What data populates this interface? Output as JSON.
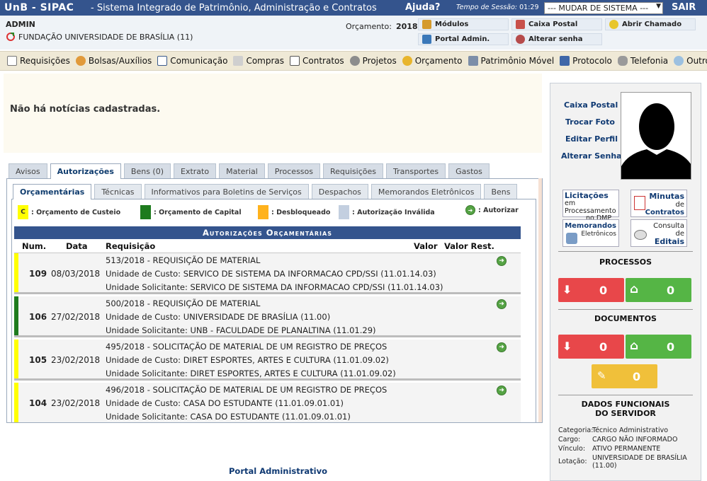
{
  "topbar": {
    "brand": "UnB - SIPAC",
    "system_name": "- Sistema Integrado de Patrimônio, Administração e Contratos",
    "help": "Ajuda?",
    "session_label": "Tempo de Sessão:",
    "session_time": "01:29",
    "system_select": "--- MUDAR DE SISTEMA ---",
    "logout": "SAIR",
    "color": "#34548d"
  },
  "user": {
    "name": "ADMIN",
    "unit": "FUNDAÇÃO UNIVERSIDADE DE BRASÍLIA (11)",
    "budget_label": "Orçamento:",
    "budget_year": "2018"
  },
  "quick_links": {
    "modules": "Módulos",
    "mailbox": "Caixa Postal",
    "open_ticket": "Abrir Chamado",
    "admin_portal": "Portal Admin.",
    "change_password": "Alterar senha"
  },
  "menu": [
    {
      "label": "Requisições",
      "icon": "document-icon"
    },
    {
      "label": "Bolsas/Auxílios",
      "icon": "people-icon"
    },
    {
      "label": "Comunicação",
      "icon": "book-icon"
    },
    {
      "label": "Compras",
      "icon": "cart-icon"
    },
    {
      "label": "Contratos",
      "icon": "contract-icon"
    },
    {
      "label": "Projetos",
      "icon": "projects-icon"
    },
    {
      "label": "Orçamento",
      "icon": "coins-icon"
    },
    {
      "label": "Patrimônio Móvel",
      "icon": "computer-icon"
    },
    {
      "label": "Protocolo",
      "icon": "protocol-icon"
    },
    {
      "label": "Telefonia",
      "icon": "phone-icon"
    },
    {
      "label": "Outros",
      "icon": "search-icon"
    }
  ],
  "news": {
    "message": "Não há notícias cadastradas."
  },
  "main_tabs": [
    "Avisos",
    "Autorizações",
    "Bens (0)",
    "Extrato",
    "Material",
    "Processos",
    "Requisições",
    "Transportes",
    "Gastos"
  ],
  "sub_tabs": [
    "Orçamentárias",
    "Técnicas",
    "Informativos para Boletins de Serviços",
    "Despachos",
    "Memorandos Eletrônicos",
    "Bens"
  ],
  "legend": {
    "custeio": ": Orçamento de Custeio",
    "custeio_mark": "C",
    "capital": ": Orçamento de Capital",
    "desbloqueado": ": Desbloqueado",
    "invalida": ": Autorização Inválida",
    "autorizar": ": Autorizar",
    "colors": {
      "custeio": "#ffff00",
      "capital": "#1e7b1e",
      "desbloqueado": "#ffb21c",
      "invalida": "#c3cfe0"
    }
  },
  "table": {
    "title": "Autorizações Orçamentárias",
    "columns": {
      "num": "Num.",
      "date": "Data",
      "req": "Requisição",
      "value": "Valor",
      "remaining": "Valor Rest."
    },
    "rows": [
      {
        "num": "109",
        "date": "08/03/2018",
        "req": "513/2018 - REQUISIÇÃO DE MATERIAL",
        "cost_unit": "Unidade de Custo: SERVICO DE SISTEMA DA INFORMACAO CPD/SSI (11.01.14.03)",
        "requesting_unit": "Unidade Solicitante: SERVICO DE SISTEMA DA INFORMACAO CPD/SSI (11.01.14.03)",
        "color": "#ffff00"
      },
      {
        "num": "106",
        "date": "27/02/2018",
        "req": "500/2018 - REQUISIÇÃO DE MATERIAL",
        "cost_unit": "Unidade de Custo: UNIVERSIDADE DE BRASÍLIA (11.00)",
        "requesting_unit": "Unidade Solicitante: UNB - FACULDADE DE PLANALTINA (11.01.29)",
        "color": "#1e7b1e"
      },
      {
        "num": "105",
        "date": "23/02/2018",
        "req": "495/2018 - SOLICITAÇÃO DE MATERIAL DE UM REGISTRO DE PREÇOS",
        "cost_unit": "Unidade de Custo: DIRET ESPORTES, ARTES E CULTURA (11.01.09.02)",
        "requesting_unit": "Unidade Solicitante: DIRET ESPORTES, ARTES E CULTURA (11.01.09.02)",
        "color": "#ffff00"
      },
      {
        "num": "104",
        "date": "23/02/2018",
        "req": "496/2018 - SOLICITAÇÃO DE MATERIAL DE UM REGISTRO DE PREÇOS",
        "cost_unit": "Unidade de Custo: CASA DO ESTUDANTE (11.01.09.01.01)",
        "requesting_unit": "Unidade Solicitante: CASA DO ESTUDANTE (11.01.09.01.01)",
        "color": "#ffff00"
      }
    ]
  },
  "footer": {
    "portal_link": "Portal Administrativo"
  },
  "sidebar": {
    "links": [
      "Caixa Postal",
      "Trocar Foto",
      "Editar Perfil",
      "Alterar Senha"
    ],
    "buttons": {
      "licitacoes": [
        "Licitações",
        "em",
        "Processamento",
        "no DMP"
      ],
      "minutas": [
        "Minutas",
        "de",
        "Contratos"
      ],
      "memorandos": [
        "Memorandos",
        "Eletrônicos"
      ],
      "editais": [
        "Consulta",
        "de",
        "Editais"
      ]
    },
    "processes_title": "PROCESSOS",
    "processes_in": "0",
    "processes_home": "0",
    "documents_title": "DOCUMENTOS",
    "documents_in": "0",
    "documents_home": "0",
    "documents_draft": "0",
    "functional_title": "DADOS FUNCIONAIS DO SERVIDOR",
    "functional": {
      "categoria_label": "Categoria:",
      "categoria": "Técnico Administrativo",
      "cargo_label": "Cargo:",
      "cargo": "CARGO NÃO INFORMADO",
      "vinculo_label": "Vínculo:",
      "vinculo": "ATIVO PERMANENTE",
      "lotacao_label": "Lotação:",
      "lotacao": "UNIVERSIDADE DE BRASÍLIA (11.00)"
    },
    "colors": {
      "red": "#e8474a",
      "green": "#55b545",
      "yellow": "#f0c03a"
    }
  }
}
